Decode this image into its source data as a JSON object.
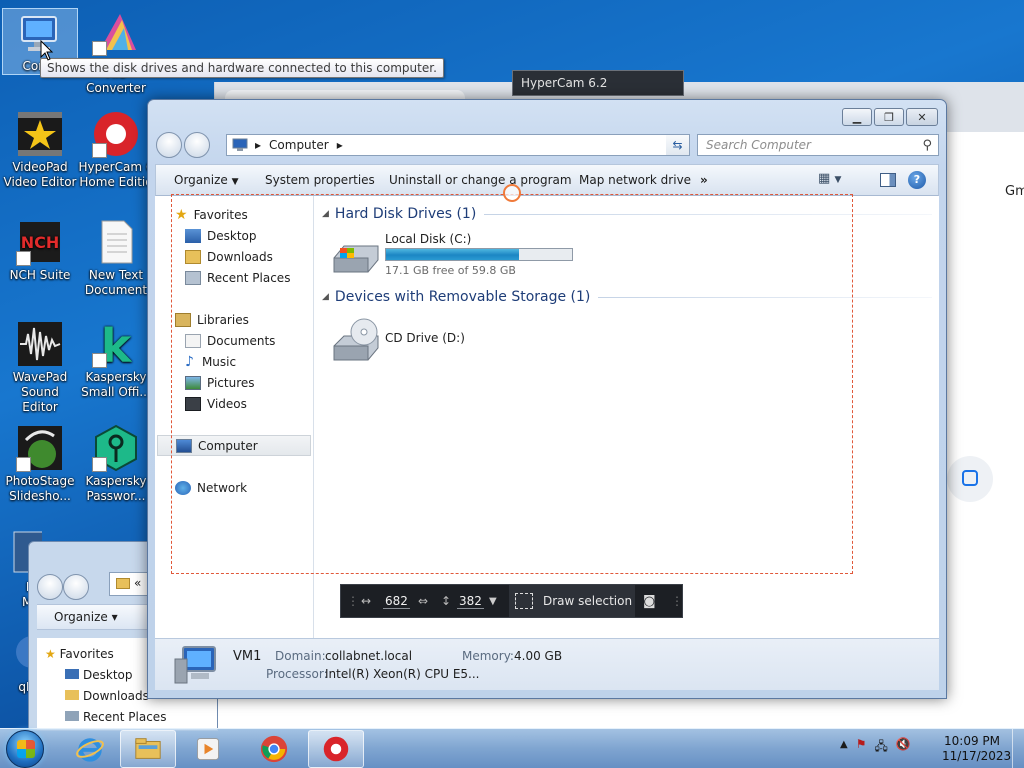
{
  "desktop": {
    "icons": [
      {
        "label": "Comp",
        "icon": "computer-icon"
      },
      {
        "label": "File Converter",
        "icon": "file-converter-icon"
      },
      {
        "label": "VideoPad Video Editor",
        "icon": "videopad-icon"
      },
      {
        "label": "HyperCam 6 Home Editio",
        "icon": "hypercam-icon"
      },
      {
        "label": "NCH Suite",
        "icon": "nch-suite-icon"
      },
      {
        "label": "New Text Document",
        "icon": "text-document-icon"
      },
      {
        "label": "WavePad Sound Editor",
        "icon": "wavepad-icon"
      },
      {
        "label": "Kaspersky Small Offi...",
        "icon": "kaspersky-small-office-icon"
      },
      {
        "label": "PhotoStage Slidesho...",
        "icon": "photostage-icon"
      },
      {
        "label": "Kaspersky Passwor...",
        "icon": "kaspersky-password-icon"
      },
      {
        "label": "M Mu",
        "icon": "media-icon"
      },
      {
        "label": "qBi",
        "icon": "qbittorrent-icon"
      }
    ],
    "tooltip": "Shows the disk drives and hardware connected to this computer."
  },
  "background_windows": {
    "browser_partial_text": "Gm",
    "hypercam_title": "HyperCam 6.2"
  },
  "explorer2": {
    "nav_chevrons": "«",
    "organize_label": "Organize ▾",
    "items": [
      "Favorites",
      "Desktop",
      "Downloads",
      "Recent Places"
    ]
  },
  "explorer": {
    "address": {
      "crumb": "Computer",
      "sep": "▸"
    },
    "search_placeholder": "Search Computer",
    "toolbar": {
      "organize": "Organize",
      "system_properties": "System properties",
      "uninstall": "Uninstall or change a program",
      "map_network": "Map network drive",
      "more": "»"
    },
    "nav": {
      "favorites": "Favorites",
      "desktop": "Desktop",
      "downloads": "Downloads",
      "recent_places": "Recent Places",
      "libraries": "Libraries",
      "documents": "Documents",
      "music": "Music",
      "pictures": "Pictures",
      "videos": "Videos",
      "computer": "Computer",
      "network": "Network"
    },
    "groups": {
      "hdd_title": "Hard Disk Drives (1)",
      "removable_title": "Devices with Removable Storage (1)"
    },
    "drives": {
      "local": {
        "name": "Local Disk (C:)",
        "free_text": "17.1 GB free of 59.8 GB",
        "used_fraction": 0.714
      },
      "cd": {
        "name": "CD Drive (D:)"
      }
    },
    "details": {
      "name": "VM1",
      "domain_label": "Domain:",
      "domain_value": "collabnet.local",
      "memory_label": "Memory:",
      "memory_value": "4.00 GB",
      "processor_label": "Processor:",
      "processor_value": "Intel(R) Xeon(R) CPU E5..."
    }
  },
  "selection_toolbar": {
    "width_value": "682",
    "height_value": "382",
    "draw_label": "Draw selection"
  },
  "taskbar": {
    "clock_time": "10:09 PM",
    "clock_date": "11/17/2023",
    "apps": [
      "explorer",
      "ie",
      "file-explorer",
      "videopad",
      "chrome",
      "hypercam"
    ]
  },
  "colors": {
    "desktop_blue": "#0d5fb4",
    "selection_outline": "#e0583a",
    "progress_fill": "#1c86c4"
  }
}
